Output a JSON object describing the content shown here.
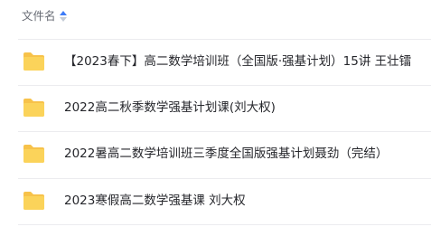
{
  "file_list": {
    "header": {
      "column_label": "文件名",
      "sort_icon": "sort-updown-icon"
    },
    "colors": {
      "folder": "#f7c24a",
      "folder_front": "#fbd35a",
      "sort_active": "#3d7bf7",
      "divider": "#ececef"
    },
    "items": [
      {
        "type": "folder",
        "icon": "folder-icon",
        "name": "【2023春下】高二数学培训班（全国版·强基计划）15讲 王壮镭"
      },
      {
        "type": "folder",
        "icon": "folder-icon",
        "name": "2022高二秋季数学强基计划课(刘大权)"
      },
      {
        "type": "folder",
        "icon": "folder-icon",
        "name": "2022暑高二数学培训班三季度全国版强基计划聂劲（完结）"
      },
      {
        "type": "folder",
        "icon": "folder-icon",
        "name": "2023寒假高二数学强基课 刘大权"
      }
    ]
  }
}
